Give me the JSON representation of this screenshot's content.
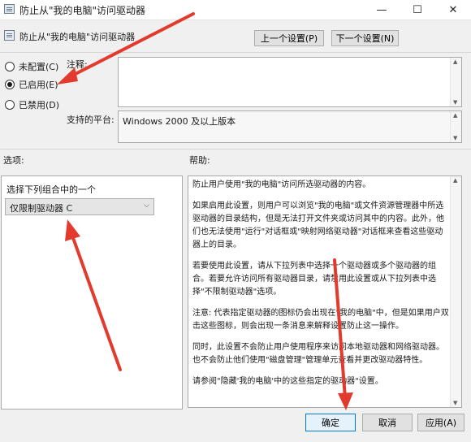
{
  "window": {
    "title": "防止从\"我的电脑\"访问驱动器",
    "minimize_glyph": "—",
    "maximize_glyph": "☐",
    "close_glyph": "✕"
  },
  "header": {
    "policy_name": "防止从\"我的电脑\"访问驱动器",
    "prev_button": "上一个设置(P)",
    "next_button": "下一个设置(N)"
  },
  "state": {
    "options": [
      {
        "label": "未配置(C)",
        "selected": false
      },
      {
        "label": "已启用(E)",
        "selected": true
      },
      {
        "label": "已禁用(D)",
        "selected": false
      }
    ]
  },
  "comment": {
    "label": "注释:",
    "value": ""
  },
  "platform": {
    "label": "支持的平台:",
    "value": "Windows 2000 及以上版本"
  },
  "options_section": {
    "label": "选项:",
    "combo_label": "选择下列组合中的一个",
    "combo_value": "仅限制驱动器 C"
  },
  "help_section": {
    "label": "帮助:",
    "paragraphs": [
      "防止用户使用\"我的电脑\"访问所选驱动器的内容。",
      "如果启用此设置，则用户可以浏览\"我的电脑\"或文件资源管理器中所选驱动器的目录结构，但是无法打开文件夹或访问其中的内容。此外，他们也无法使用\"运行\"对话框或\"映射网络驱动器\"对话框来查看这些驱动器上的目录。",
      "若要使用此设置，请从下拉列表中选择一个驱动器或多个驱动器的组合。若要允许访问所有驱动器目录，请禁用此设置或从下拉列表中选择\"不限制驱动器\"选项。",
      "注意: 代表指定驱动器的图标仍会出现在\"我的电脑\"中，但是如果用户双击这些图标，则会出现一条消息来解释设置防止这一操作。",
      "同时，此设置不会防止用户使用程序来访问本地驱动器和网络驱动器。也不会防止他们使用\"磁盘管理\"管理单元查看并更改驱动器特性。",
      "请参阅\"隐藏'我的电脑'中的这些指定的驱动器\"设置。"
    ]
  },
  "footer": {
    "ok_button": "确定",
    "cancel_button": "取消",
    "apply_button": "应用(A)"
  },
  "colors": {
    "annotation_arrow": "#e23b2e",
    "window_bg": "#f0f0f0"
  }
}
